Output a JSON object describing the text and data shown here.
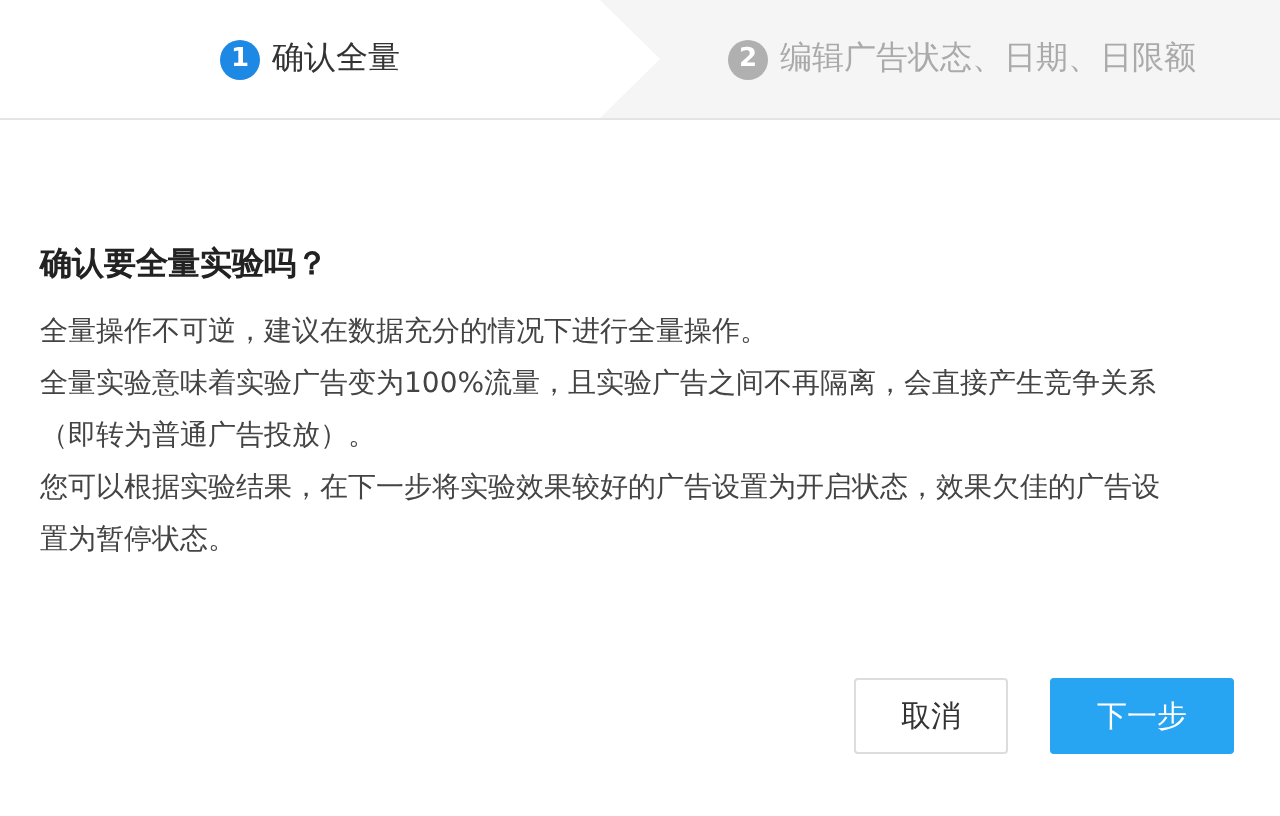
{
  "steps": [
    {
      "number": "1",
      "label": "确认全量",
      "selected": true
    },
    {
      "number": "2",
      "label": "编辑广告状态、日期、日限额",
      "selected": false
    }
  ],
  "title": "确认要全量实验吗？",
  "paragraphs": [
    "全量操作不可逆，建议在数据充分的情况下进行全量操作。",
    "全量实验意味着实验广告变为100%流量，且实验广告之间不再隔离，会直接产生竞争关系（即转为普通广告投放）。",
    "您可以根据实验结果，在下一步将实验效果较好的广告设置为开启状态，效果欠佳的广告设置为暂停状态。"
  ],
  "buttons": [
    {
      "label": "取消",
      "kind": "secondary"
    },
    {
      "label": "下一步",
      "kind": "primary"
    }
  ]
}
